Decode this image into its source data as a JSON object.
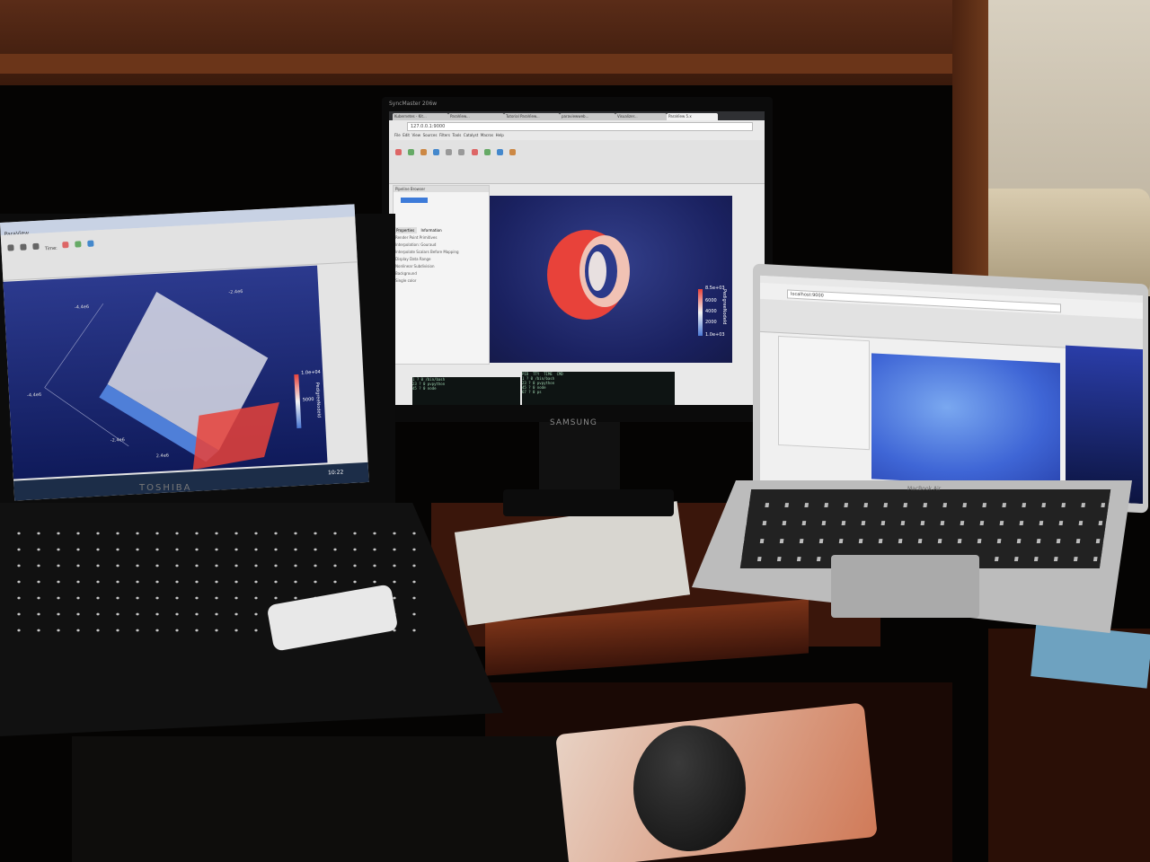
{
  "scene": {
    "monitor": {
      "brand": "SyncMaster 206w",
      "bezel_brand": "SAMSUNG",
      "browser_tabs": [
        "Kubernetes - Kit...",
        "ParaView...",
        "Tutorial ParaView...",
        "paraviewweb...",
        "Visualizer...",
        "ParaView 5.x"
      ],
      "url": "127.0.0.1:9000",
      "menu": [
        "File",
        "Edit",
        "View",
        "Sources",
        "Filters",
        "Tools",
        "Catalyst",
        "Macros",
        "Help"
      ],
      "pipeline_title": "Pipeline Browser",
      "panel_tabs": [
        "Properties",
        "Information"
      ],
      "panel_items": [
        "Render Point Primitives",
        "Interpolation: Gouraud",
        "Interpolate Scalars Before Mapping",
        "Display Data Range",
        "Nonlinear Subdivision",
        "Background",
        "Single color"
      ],
      "colorbar": {
        "max_label": "8.5e+03",
        "ticks": [
          "6000",
          "4000",
          "2000"
        ],
        "min_label": "1.0e+03",
        "title": "PedigreeNodeId"
      },
      "terminal_headers": [
        "PID",
        "TTY",
        "TIME",
        "CMD"
      ],
      "terminal_lines": [
        "1  ?  0  /bin/bash",
        "23 ?  0  pvpython",
        "45 ?  0  node",
        "67 ?  0  ps"
      ]
    },
    "toshiba": {
      "brand": "TOSHIBA",
      "app_title": "ParaView",
      "time_label": "Time:",
      "colorbar": {
        "max_label": "1.0e+04",
        "mid_label": "5000",
        "title": "PedigreeNodeId"
      },
      "axis_labels": [
        "-4.4e6",
        "-2.4e6",
        "-4.4e6",
        "-2.4e6",
        "2.4e6"
      ],
      "taskbar_clock": "10:22"
    },
    "macbook": {
      "brand": "MacBook Air",
      "url": "localhost:9000",
      "colors": {
        "render_bg": "#3f66d6"
      }
    },
    "colors": {
      "paraview_red": "#e8423a",
      "paraview_blue": "#1d2a7a",
      "wood": "#5a2c18"
    }
  }
}
